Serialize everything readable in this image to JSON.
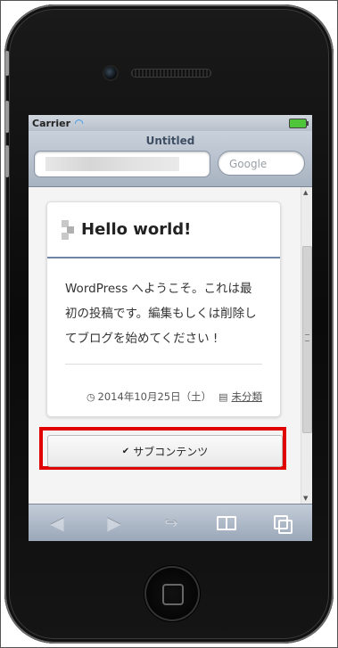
{
  "status_bar": {
    "carrier": "Carrier"
  },
  "browser": {
    "title": "Untitled",
    "search_placeholder": "Google"
  },
  "post": {
    "title": "Hello world!",
    "body": "WordPress へようこそ。これは最初の投稿です。編集もしくは削除してブログを始めてください !",
    "date": "2014年10月25日（土）",
    "category": "未分類"
  },
  "subcontent_button": {
    "label": "サブコンテンツ"
  },
  "toolbar": {
    "back": "back-icon",
    "forward": "forward-icon",
    "share": "share-icon",
    "bookmarks": "bookmarks-icon",
    "pages": "pages-icon"
  },
  "colors": {
    "highlight": "#e00000",
    "title_rule": "#6d86a6",
    "battery": "#4fc63a"
  }
}
